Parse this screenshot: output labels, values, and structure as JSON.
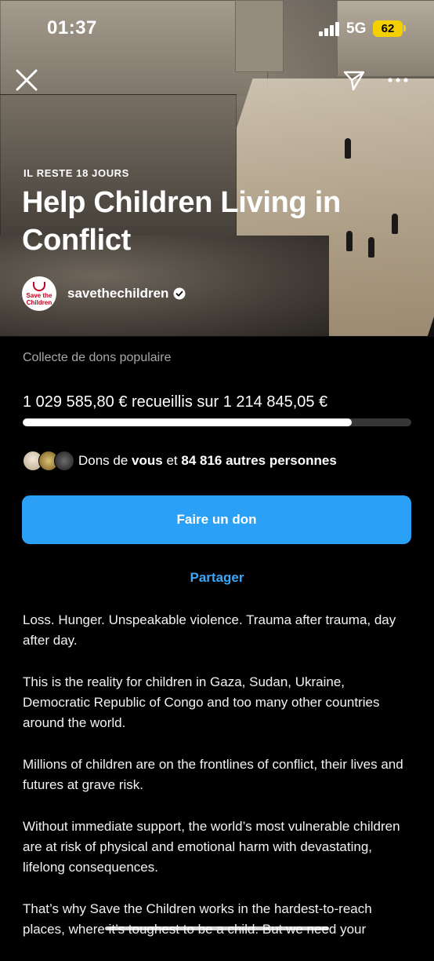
{
  "status_bar": {
    "time": "01:37",
    "network": "5G",
    "battery": "62"
  },
  "hero": {
    "days_left": "IL RESTE 18 JOURS",
    "title": "Help Children Living in Conflict",
    "org_logo_text": [
      "Save the",
      "Children"
    ],
    "org_name": "savethechildren",
    "icons": [
      "close-icon",
      "share-icon",
      "more-icon",
      "verified-icon"
    ]
  },
  "fundraiser": {
    "popular_label": "Collecte de dons populaire",
    "raised_text": "1 029 585,80 € recueillis sur 1 214 845,05 €",
    "progress_fraction": 0.8475,
    "donors_prefix": "Dons de ",
    "donors_you": "vous",
    "donors_middle": " et ",
    "donors_count": "84 816 autres personnes",
    "donate_label": "Faire un don",
    "share_label": "Partager"
  },
  "description": [
    "Loss. Hunger. Unspeakable violence. Trauma after trauma, day after day.",
    "This is the reality for children in Gaza, Sudan, Ukraine, Democratic Republic of Congo and too many other countries around the world.",
    "Millions of children are on the frontlines of conflict, their lives and futures at grave risk.",
    "Without immediate support, the world’s most vulnerable children are at risk of physical and emotional harm with devastating, lifelong consequences.",
    "That’s why Save the Children works in the hardest-to-reach places, where it’s toughest to be a child. But we need your"
  ],
  "colors": {
    "accent": "#2aa0f6",
    "link": "#3ea6f5",
    "battery": "#f5d000",
    "background": "#000000"
  }
}
